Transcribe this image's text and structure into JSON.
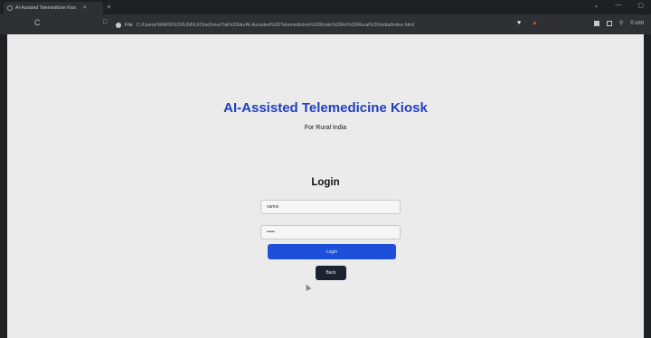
{
  "browser": {
    "tab_title": "AI-Assisted Telemedicine Kios",
    "tab_close": "×",
    "new_tab": "+",
    "window_controls": [
      "⌄",
      "—",
      "▢"
    ],
    "refresh_glyph": "C",
    "bookmark_glyph": "□",
    "file_label": "File",
    "url": "C:/Users/VAMSI%20/UNNU/OneDrive/Tai%20lilu/AI-Assisted%20Telemedicine%20Kiosk%20for%20Rural%20India/index.html",
    "extension_icons": [
      "shield-icon",
      "warning-icon"
    ],
    "right_text": "0 cmt"
  },
  "page": {
    "title": "AI-Assisted Telemedicine Kiosk",
    "subtitle": "For Rural India",
    "login_heading": "Login",
    "username_value": "vamsi",
    "password_value": "•••••",
    "login_button": "Login",
    "back_button": "Back"
  },
  "colors": {
    "title": "#1f3fbf",
    "login_button": "#1d4fd8",
    "back_button": "#1c2330",
    "page_bg": "#ebebeb"
  }
}
